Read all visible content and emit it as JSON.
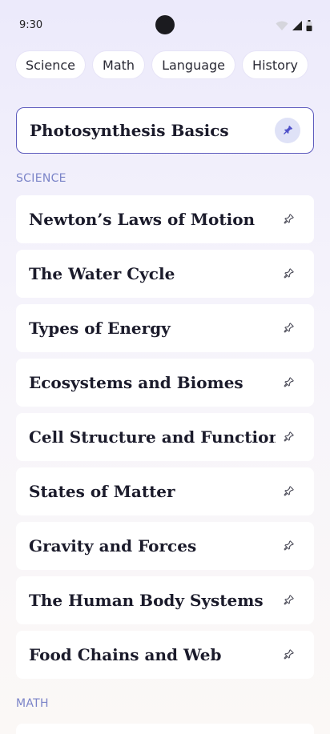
{
  "status": {
    "time": "9:30"
  },
  "chips": [
    "Science",
    "Math",
    "Language",
    "History"
  ],
  "pinned": {
    "title": "Photosynthesis Basics"
  },
  "sections": {
    "science": "SCIENCE",
    "math": "MATH"
  },
  "science_items": [
    {
      "label": "Newton’s Laws of Motion"
    },
    {
      "label": "The Water Cycle"
    },
    {
      "label": "Types of Energy"
    },
    {
      "label": "Ecosystems and Biomes"
    },
    {
      "label": "Cell Structure and Function"
    },
    {
      "label": "States of Matter"
    },
    {
      "label": "Gravity and Forces"
    },
    {
      "label": "The Human Body Systems"
    },
    {
      "label": "Food Chains and Web"
    }
  ],
  "colors": {
    "accent": "#5d5bbd",
    "section": "#7b84c8",
    "pin_bg": "#dfe2f7"
  },
  "icons": {
    "pinned": "pin-filled-icon",
    "unpinned": "pin-outline-icon"
  }
}
